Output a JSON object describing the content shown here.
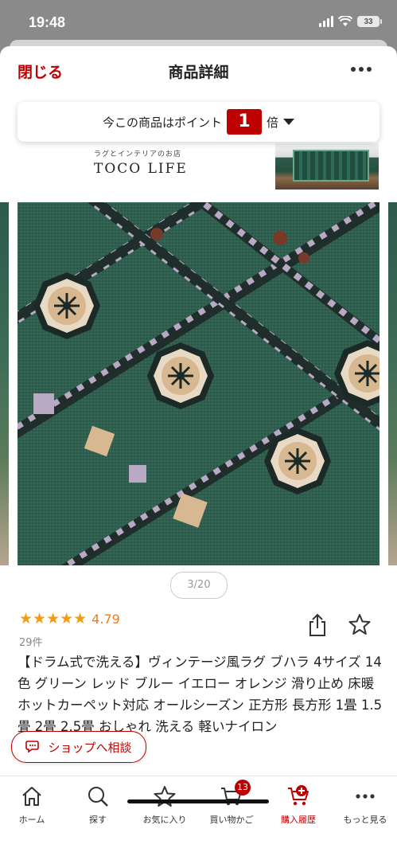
{
  "status_bar": {
    "time": "19:48",
    "battery": "33"
  },
  "header": {
    "close_label": "閉じる",
    "title": "商品詳細"
  },
  "banner": {
    "shop_sub": "ラグとインテリアのお店",
    "shop_logo": "TOCO LIFE"
  },
  "points": {
    "prefix": "今この商品はポイント",
    "multiplier": "1",
    "suffix": "倍"
  },
  "gallery": {
    "counter": "3/20",
    "current_index": 3,
    "total": 20
  },
  "rating": {
    "stars": "★★★★★",
    "score": "4.79",
    "reviews": "29件"
  },
  "product": {
    "title": "【ドラム式で洗える】ヴィンテージ風ラグ ブハラ 4サイズ 14色 グリーン レッド ブルー イエロー オレンジ 滑り止め 床暖 ホットカーペット対応 オールシーズン 正方形 長方形 1畳 1.5畳 2畳 2.5畳 おしゃれ 洗える 軽いナイロン"
  },
  "consult": {
    "label": "ショップへ相談"
  },
  "nav": {
    "items": [
      {
        "label": "ホーム",
        "icon": "home-icon"
      },
      {
        "label": "探す",
        "icon": "search-icon"
      },
      {
        "label": "お気に入り",
        "icon": "star-icon"
      },
      {
        "label": "買い物かご",
        "icon": "cart-icon",
        "badge": "13"
      },
      {
        "label": "購入履歴",
        "icon": "purchase-history-icon"
      },
      {
        "label": "もっと見る",
        "icon": "more-icon"
      }
    ]
  },
  "colors": {
    "accent": "#bf0000",
    "star": "#f39c12",
    "rug_green": "#2e5e4e"
  }
}
